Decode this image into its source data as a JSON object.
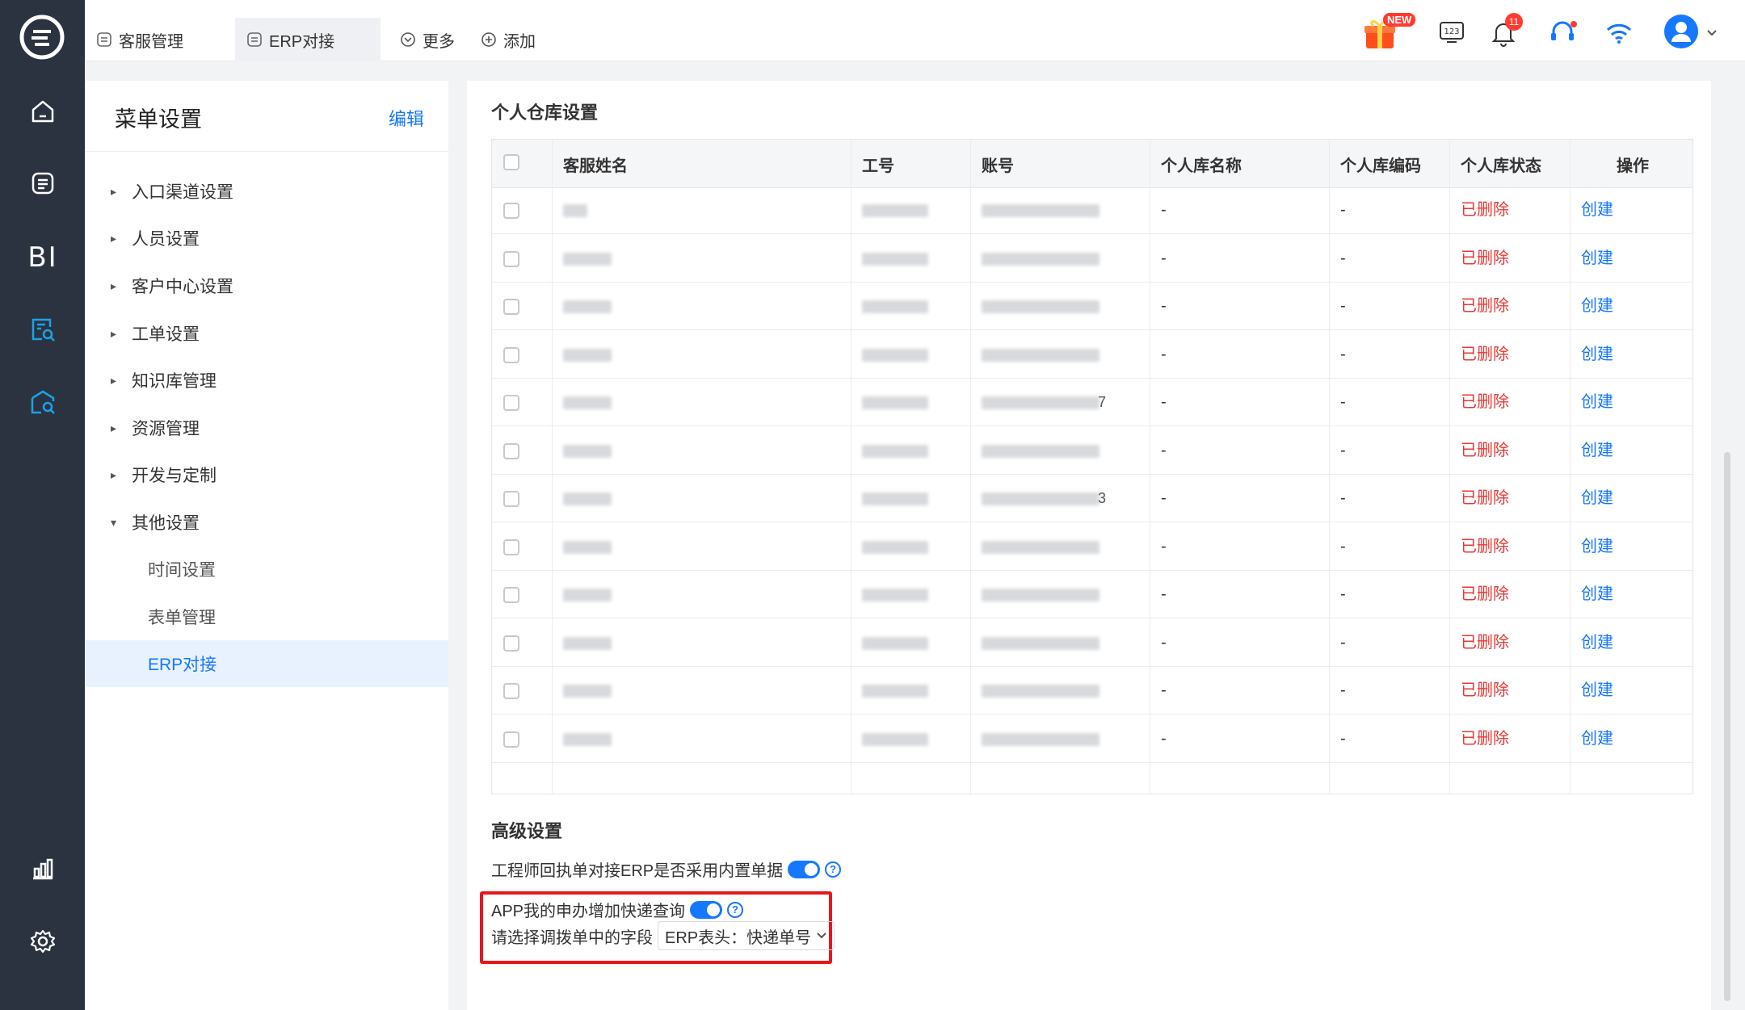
{
  "tabs": [
    {
      "label": "客服管理",
      "icon": "doc-icon",
      "active": false
    },
    {
      "label": "ERP对接",
      "icon": "doc-icon",
      "active": true
    },
    {
      "label": "更多",
      "icon": "chevron-circle-icon",
      "active": false
    },
    {
      "label": "添加",
      "icon": "plus-circle-icon",
      "active": false
    }
  ],
  "top_right": {
    "gift_badge": "NEW",
    "bell_count": "11",
    "keyboard_label": "123"
  },
  "rail": {
    "bi_label": "BI"
  },
  "menu": {
    "title": "菜单设置",
    "edit_label": "编辑",
    "items": [
      {
        "label": "入口渠道设置",
        "arrow": "▸"
      },
      {
        "label": "人员设置",
        "arrow": "▸"
      },
      {
        "label": "客户中心设置",
        "arrow": "▸"
      },
      {
        "label": "工单设置",
        "arrow": "▸"
      },
      {
        "label": "知识库管理",
        "arrow": "▸"
      },
      {
        "label": "资源管理",
        "arrow": "▸"
      },
      {
        "label": "开发与定制",
        "arrow": "▸"
      },
      {
        "label": "其他设置",
        "arrow": "▾"
      }
    ],
    "sub_items": [
      {
        "label": "时间设置"
      },
      {
        "label": "表单管理"
      },
      {
        "label": "ERP对接",
        "selected": true
      }
    ]
  },
  "warehouse": {
    "title": "个人仓库设置",
    "columns": [
      "客服姓名",
      "工号",
      "账号",
      "个人库名称",
      "个人库编码",
      "个人库状态",
      "操作"
    ],
    "row_values": {
      "name": "-",
      "code": "-",
      "status": "已删除",
      "action": "创建"
    },
    "row_count": 12,
    "account_suffixes": [
      "",
      "",
      "",
      "",
      "7",
      "",
      "3",
      "",
      "",
      "",
      "",
      ""
    ]
  },
  "advanced": {
    "title": "高级设置",
    "option1_label": "工程师回执单对接ERP是否采用内置单据",
    "option1_enabled": true,
    "option2_label": "APP我的申办增加快递查询",
    "option2_enabled": true,
    "field_label": "请选择调拨单中的字段",
    "field_value": "ERP表头：快递单号"
  },
  "colors": {
    "accent": "#1677ff",
    "danger": "#e53935",
    "rail": "#2b3340"
  }
}
